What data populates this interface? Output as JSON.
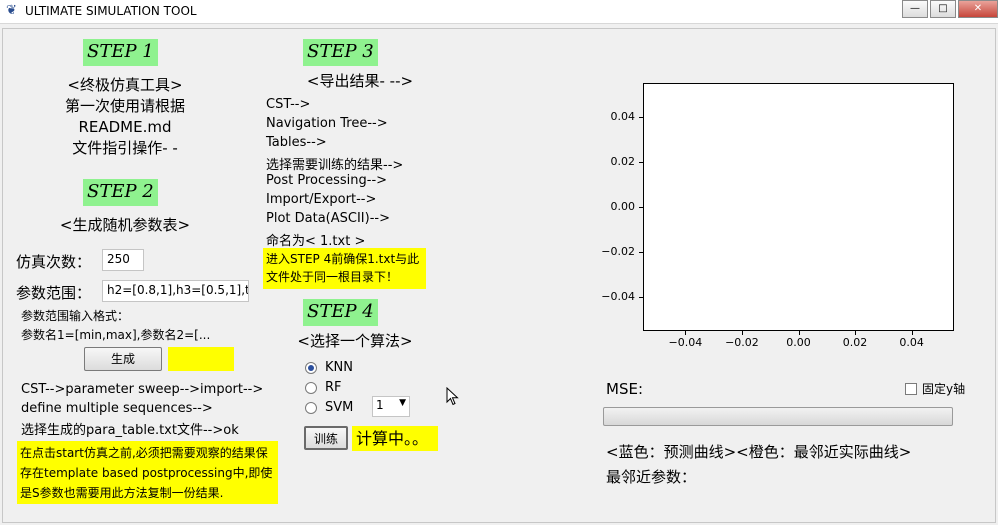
{
  "window": {
    "title": "ULTIMATE SIMULATION TOOL",
    "controls": [
      "minimize",
      "maximize",
      "close"
    ]
  },
  "step1": {
    "label": "STEP 1",
    "title": "<终极仿真工具>",
    "line1": "第一次使用请根据",
    "line2": "README.md",
    "line3": "文件指引操作- -"
  },
  "step2": {
    "label": "STEP 2",
    "title": "<生成随机参数表>",
    "sim_count_label": "仿真次数：",
    "sim_count_value": "250",
    "range_label": "参数范围：",
    "range_value": "h2=[0.8,1],h3=[0.5,1],t1=",
    "format_line1": "参数范围输入格式：",
    "format_line2": "参数名1=[min,max],参数名2=[...",
    "generate_button": "生成",
    "path1": "CST-->parameter sweep-->import-->",
    "path2": "define multiple sequences-->",
    "path3": "选择生成的para_table.txt文件-->ok",
    "note": "在点击start仿真之前,必须把需要观察的结果保存在template based postprocessing中,即使是S参数也需要用此方法复制一份结果."
  },
  "step3": {
    "label": "STEP 3",
    "title": "<导出结果- -->",
    "items": [
      "CST-->",
      "Navigation Tree-->",
      "Tables-->",
      "选择需要训练的结果-->",
      "Post Processing-->",
      "Import/Export-->",
      "Plot Data(ASCII)-->",
      "命名为< 1.txt >"
    ],
    "note": "进入STEP 4前确保1.txt与此文件处于同一根目录下！"
  },
  "step4": {
    "label": "STEP 4",
    "title": "<选择一个算法>",
    "options": [
      "KNN",
      "RF",
      "SVM"
    ],
    "selected": "KNN",
    "svm_param": "1",
    "train_button": "训练",
    "status": "计算中。。"
  },
  "plot": {
    "yticks": [
      "0.04",
      "0.02",
      "0.00",
      "−0.02",
      "−0.04"
    ],
    "xticks": [
      "−0.04",
      "−0.02",
      "0.00",
      "0.02",
      "0.04"
    ],
    "xlim": [
      -0.055,
      0.055
    ],
    "ylim": [
      -0.055,
      0.055
    ]
  },
  "results": {
    "mse_label": "MSE:",
    "fix_y_label": "固定y轴",
    "fix_y_checked": false,
    "progress": 0,
    "legend": "<蓝色：预测曲线><橙色：最邻近实际曲线>",
    "nearest_params": "最邻近参数："
  },
  "colors": {
    "step_badge": "#8ff28f",
    "highlight": "#ffff00"
  }
}
